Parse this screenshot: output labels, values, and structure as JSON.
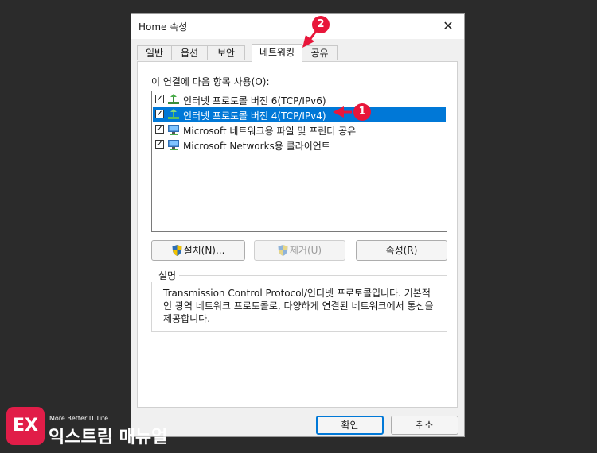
{
  "window": {
    "title": "Home 속성",
    "close_glyph": "✕"
  },
  "tabs": [
    {
      "label": "일반"
    },
    {
      "label": "옵션"
    },
    {
      "label": "보안"
    },
    {
      "label": "네트워킹"
    },
    {
      "label": "공유"
    }
  ],
  "connection_label": "이 연결에 다음 항목 사용(O):",
  "items": [
    {
      "label": "인터넷 프로토콜 버전 6(TCP/IPv6)",
      "checked": true,
      "icon": "network-protocol-icon"
    },
    {
      "label": "인터넷 프로토콜 버전 4(TCP/IPv4)",
      "checked": true,
      "icon": "network-protocol-icon",
      "selected": true
    },
    {
      "label": "Microsoft 네트워크용 파일 및 프린터 공유",
      "checked": true,
      "icon": "network-computer-icon"
    },
    {
      "label": "Microsoft Networks용 클라이언트",
      "checked": true,
      "icon": "network-computer-icon"
    }
  ],
  "buttons": {
    "install": "설치(N)...",
    "remove": "제거(U)",
    "properties": "속성(R)"
  },
  "description": {
    "legend": "설명",
    "text": "Transmission Control Protocol/인터넷 프로토콜입니다. 기본적인 광역 네트워크 프로토콜로, 다양하게 연결된 네트워크에서 통신을 제공합니다."
  },
  "footer": {
    "ok": "확인",
    "cancel": "취소"
  },
  "annotations": [
    {
      "number": "1"
    },
    {
      "number": "2"
    }
  ],
  "logo": {
    "tagline": "More Better IT Life",
    "name": "익스트림 매뉴얼",
    "mark": "EX"
  },
  "colors": {
    "accent": "#e8163a",
    "selection": "#0078d7",
    "logo_bg": "#e11d48"
  }
}
